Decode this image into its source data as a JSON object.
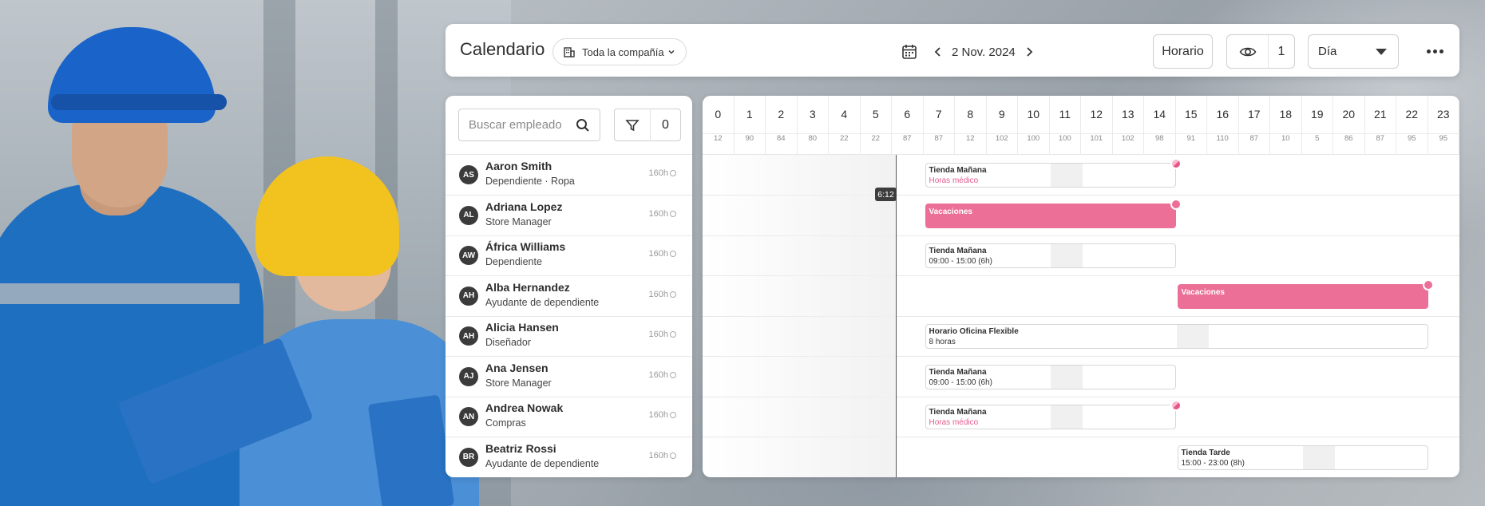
{
  "header": {
    "title": "Calendario",
    "company": "Toda la compañía",
    "date": "2 Nov. 2024",
    "schedule_button": "Horario",
    "visible_count": "1",
    "view": "Día"
  },
  "sidebar": {
    "search_placeholder": "Buscar empleado",
    "filter_count": "0",
    "employees": [
      {
        "initials": "AS",
        "name": "Aaron Smith",
        "role": "Dependiente · Ropa",
        "hours": "160h"
      },
      {
        "initials": "AL",
        "name": "Adriana Lopez",
        "role": "Store Manager",
        "hours": "160h"
      },
      {
        "initials": "AW",
        "name": "África Williams",
        "role": "Dependiente",
        "hours": "160h"
      },
      {
        "initials": "AH",
        "name": "Alba Hernandez",
        "role": "Ayudante de dependiente",
        "hours": "160h"
      },
      {
        "initials": "AH",
        "name": "Alicia Hansen",
        "role": "Diseñador",
        "hours": "160h"
      },
      {
        "initials": "AJ",
        "name": "Ana Jensen",
        "role": "Store Manager",
        "hours": "160h"
      },
      {
        "initials": "AN",
        "name": "Andrea Nowak",
        "role": "Compras",
        "hours": "160h"
      },
      {
        "initials": "BR",
        "name": "Beatriz Rossi",
        "role": "Ayudante de dependiente",
        "hours": "160h"
      }
    ]
  },
  "timeline": {
    "hours": [
      "0",
      "1",
      "2",
      "3",
      "4",
      "5",
      "6",
      "7",
      "8",
      "9",
      "10",
      "11",
      "12",
      "13",
      "14",
      "15",
      "16",
      "17",
      "18",
      "19",
      "20",
      "21",
      "22",
      "23"
    ],
    "counts": [
      "12",
      "90",
      "84",
      "80",
      "22",
      "22",
      "87",
      "87",
      "12",
      "102",
      "100",
      "100",
      "101",
      "102",
      "98",
      "91",
      "110",
      "87",
      "10",
      "5",
      "86",
      "87",
      "95",
      "95"
    ],
    "now_label": "6:12",
    "shifts": [
      {
        "row": 0,
        "start": 7,
        "end": 15,
        "title": "Tienda Mañana",
        "sub": "Horas médico",
        "sub_pink": true,
        "break": 11,
        "dot": "half",
        "vac": false
      },
      {
        "row": 1,
        "start": 7,
        "end": 15,
        "title": "Vacaciones",
        "sub": "",
        "sub_pink": false,
        "break": null,
        "dot": "full",
        "vac": true
      },
      {
        "row": 2,
        "start": 7,
        "end": 15,
        "title": "Tienda Mañana",
        "sub": "09:00 - 15:00 (6h)",
        "sub_pink": false,
        "break": 11,
        "dot": null,
        "vac": false
      },
      {
        "row": 3,
        "start": 15,
        "end": 23,
        "title": "Vacaciones",
        "sub": "",
        "sub_pink": false,
        "break": null,
        "dot": "full",
        "vac": true
      },
      {
        "row": 4,
        "start": 7,
        "end": 23,
        "title": "Horario Oficina Flexible",
        "sub": "8 horas",
        "sub_pink": false,
        "break": 15,
        "dot": null,
        "vac": false
      },
      {
        "row": 5,
        "start": 7,
        "end": 15,
        "title": "Tienda Mañana",
        "sub": "09:00 - 15:00 (6h)",
        "sub_pink": false,
        "break": 11,
        "dot": null,
        "vac": false
      },
      {
        "row": 6,
        "start": 7,
        "end": 15,
        "title": "Tienda Mañana",
        "sub": "Horas médico",
        "sub_pink": true,
        "break": 11,
        "dot": "half",
        "vac": false
      },
      {
        "row": 7,
        "start": 15,
        "end": 23,
        "title": "Tienda Tarde",
        "sub": "15:00 - 23:00 (8h)",
        "sub_pink": false,
        "break": 19,
        "dot": null,
        "vac": false
      }
    ]
  },
  "colors": {
    "accent_pink": "#ec6f97",
    "dark": "#3b3b3b"
  }
}
